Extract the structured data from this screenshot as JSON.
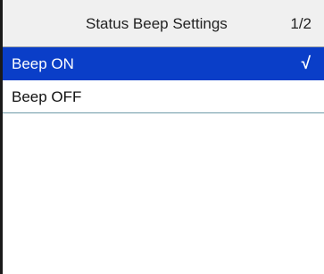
{
  "header": {
    "title": "Status Beep Settings",
    "page_indicator": "1/2"
  },
  "menu": {
    "items": [
      {
        "label": "Beep ON",
        "selected": true,
        "check_mark": "√"
      },
      {
        "label": "Beep OFF",
        "selected": false
      }
    ]
  },
  "colors": {
    "selected_row": "#0a3ec8",
    "header_bg": "#f0f0f0"
  }
}
